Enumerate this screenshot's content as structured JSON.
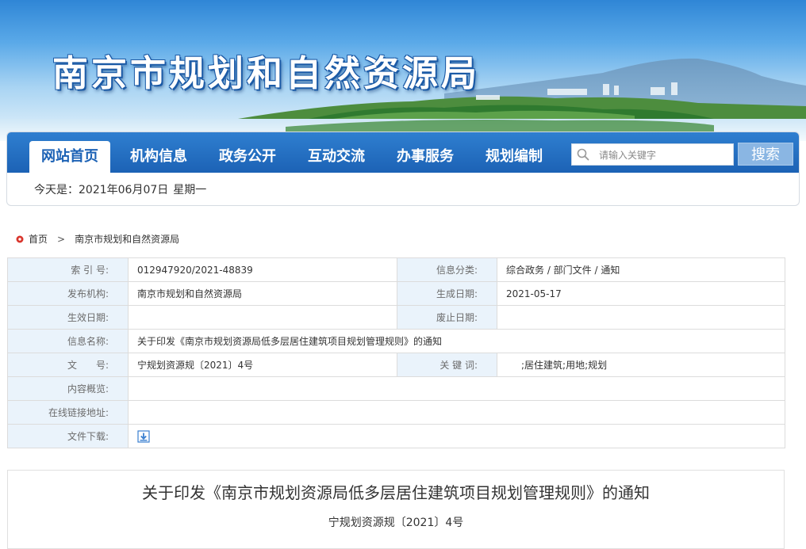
{
  "site": {
    "title": "南京市规划和自然资源局"
  },
  "nav": {
    "items": [
      "网站首页",
      "机构信息",
      "政务公开",
      "互动交流",
      "办事服务",
      "规划编制"
    ],
    "active_index": 0
  },
  "search": {
    "placeholder": "请输入关键字",
    "button_label": "搜索"
  },
  "date_bar": {
    "prefix": "今天是：",
    "date": "2021年06月07日",
    "weekday": "星期一"
  },
  "breadcrumb": {
    "home": "首页",
    "separator": ">",
    "current": "南京市规划和自然资源局"
  },
  "meta": {
    "index_no_label": "索 引 号:",
    "index_no": "012947920/2021-48839",
    "category_label": "信息分类:",
    "category": "综合政务 / 部门文件 / 通知",
    "issuer_label": "发布机构:",
    "issuer": "南京市规划和自然资源局",
    "created_label": "生成日期:",
    "created": "2021-05-17",
    "effective_label": "生效日期:",
    "effective": "",
    "expired_label": "废止日期:",
    "expired": "",
    "name_label": "信息名称:",
    "name": "关于印发《南京市规划资源局低多层居住建筑项目规划管理规则》的通知",
    "doc_no_label": "文　　号:",
    "doc_no": "宁规划资源规〔2021〕4号",
    "keywords_label": "关 键 词:",
    "keywords": ";居住建筑;用地;规划",
    "summary_label": "内容概览:",
    "summary": "",
    "link_label": "在线链接地址:",
    "link": "",
    "download_label": "文件下载:"
  },
  "article": {
    "title": "关于印发《南京市规划资源局低多层居住建筑项目规划管理规则》的通知",
    "doc_no": "宁规划资源规〔2021〕4号"
  },
  "colors": {
    "nav_blue": "#1c62b5",
    "label_bg": "#eaf3fb",
    "search_button": "#8ab6e3"
  }
}
